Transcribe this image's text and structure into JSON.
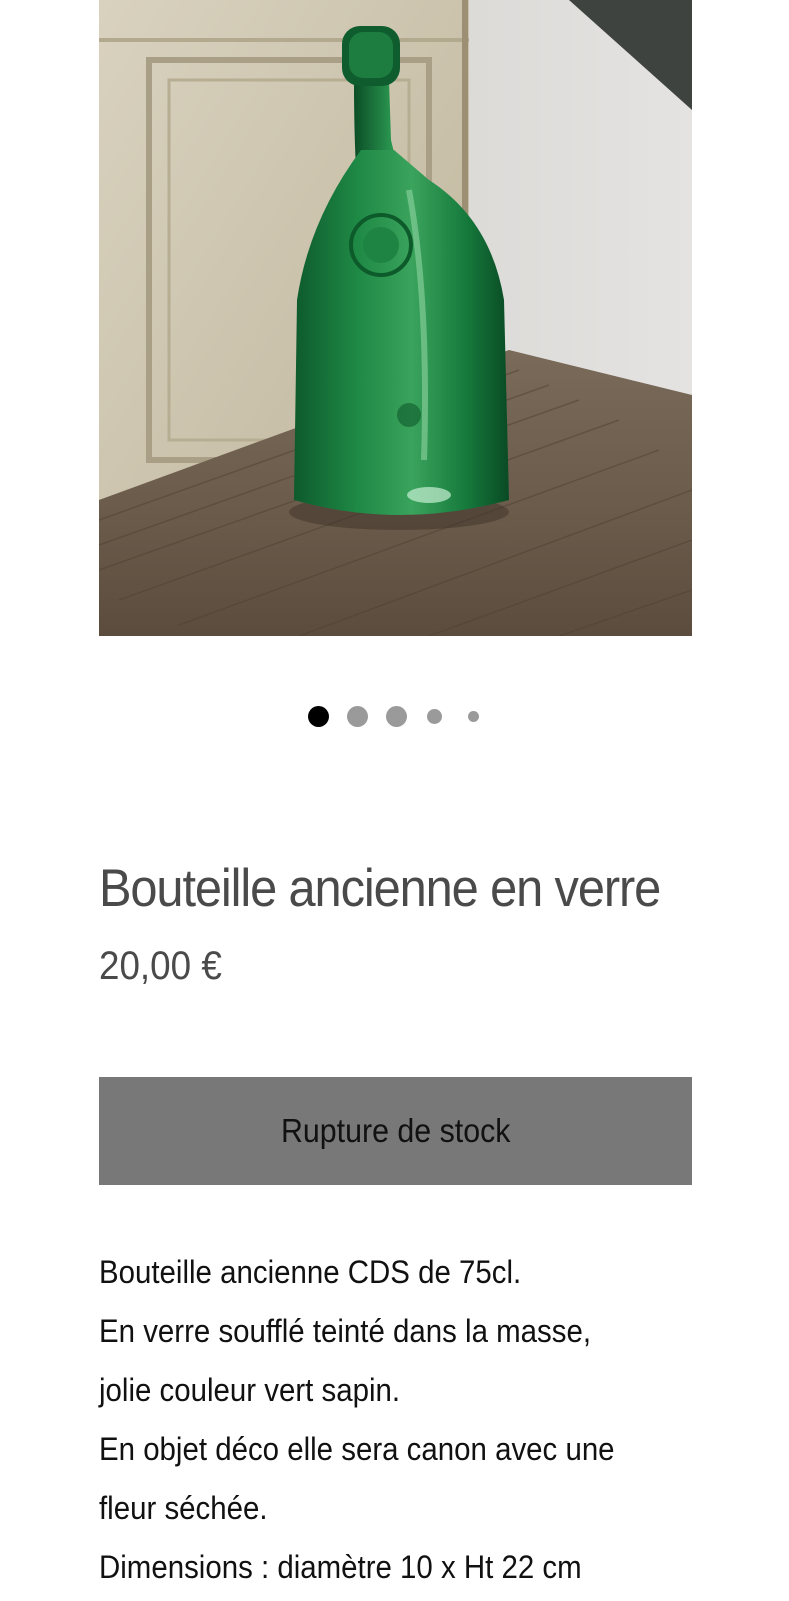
{
  "product": {
    "title": "Bouteille ancienne en verre",
    "price": "20,00 €",
    "stock_button_label": "Rupture de stock",
    "image_description": "Green glass bottle on a wooden table",
    "description_lines": [
      "Bouteille ancienne CDS de 75cl.",
      "En verre soufflé teinté dans la masse,",
      "jolie couleur vert sapin.",
      "En objet déco elle sera canon avec une",
      "fleur séchée.",
      "Dimensions : diamètre 10 x Ht 22 cm"
    ]
  },
  "carousel": {
    "total_slides": 5,
    "active_index": 0
  },
  "colors": {
    "button_bg": "#787878",
    "title_text": "#4a4a4a",
    "body_text": "#111111",
    "dot_active": "#000000",
    "dot_inactive": "#9a9a9a"
  }
}
